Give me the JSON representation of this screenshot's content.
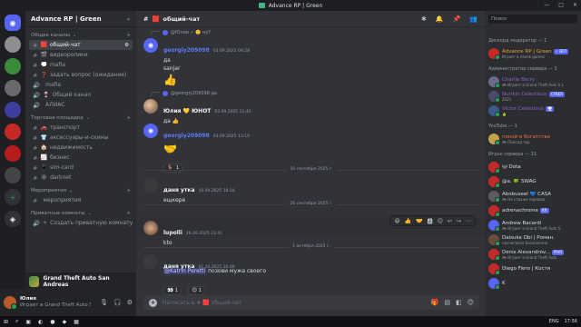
{
  "window": {
    "title": "Advance RP | Green",
    "controls": [
      "—",
      "□",
      "✕"
    ]
  },
  "servers": [
    {
      "icon": "home-icon",
      "glyph": "◉",
      "color": "#5865f2"
    },
    {
      "icon": "server-1-icon",
      "glyph": "",
      "color": "#8e8e8e"
    },
    {
      "icon": "server-2-icon",
      "glyph": "",
      "color": "#3b8b3b"
    },
    {
      "icon": "server-3-icon",
      "glyph": "",
      "color": "#6a6a6a"
    },
    {
      "icon": "server-4-icon",
      "glyph": "",
      "color": "#3c3f9e"
    },
    {
      "icon": "server-5-icon",
      "glyph": "",
      "color": "#c62828"
    },
    {
      "icon": "server-6-icon",
      "glyph": "",
      "color": "#b71c1c"
    },
    {
      "icon": "server-7-icon",
      "glyph": "",
      "color": "#444"
    },
    {
      "icon": "add-server-icon",
      "glyph": "+",
      "color": "#313338"
    },
    {
      "icon": "discover-icon",
      "glyph": "◈",
      "color": "#313338"
    }
  ],
  "guild": {
    "name": "Advance RP | Green"
  },
  "categories": [
    {
      "name": "Общие каналы",
      "channels": [
        {
          "label": "общий-чат",
          "prefix": "#",
          "emoji": "🟥",
          "active": true
        },
        {
          "label": "видеоролики",
          "prefix": "#",
          "emoji": "🎬",
          "active": false
        },
        {
          "label": "mafia",
          "prefix": "#",
          "emoji": "💭",
          "active": false
        },
        {
          "label": "задать вопрос (ожидание)",
          "prefix": "#",
          "emoji": "❓",
          "active": false
        },
        {
          "label": "mafia",
          "prefix": "🔊",
          "emoji": "",
          "active": false
        },
        {
          "label": "Общий канал",
          "prefix": "🔊",
          "emoji": "🍷",
          "active": false
        },
        {
          "label": "АЛИАС",
          "prefix": "🔊",
          "emoji": "",
          "active": false
        }
      ]
    },
    {
      "name": "Торговая площадка",
      "channels": [
        {
          "label": "транспорт",
          "prefix": "#",
          "emoji": "🚗",
          "active": false
        },
        {
          "label": "аксессуары-и-скины",
          "prefix": "#",
          "emoji": "👕",
          "active": false
        },
        {
          "label": "недвижимость",
          "prefix": "#",
          "emoji": "🏠",
          "active": false
        },
        {
          "label": "бизнес",
          "prefix": "#",
          "emoji": "📈",
          "active": false
        },
        {
          "label": "sim-card",
          "prefix": "#",
          "emoji": "📱",
          "active": false
        },
        {
          "label": "darknet",
          "prefix": "#",
          "emoji": "🕸",
          "active": false
        }
      ]
    },
    {
      "name": "Мероприятия",
      "channels": [
        {
          "label": "мероприятия",
          "prefix": "#",
          "emoji": "",
          "active": false
        }
      ]
    },
    {
      "name": "Приватные комнаты",
      "channels": [
        {
          "label": "Создать приватную комнату",
          "prefix": "🔊",
          "emoji": "+",
          "active": false
        }
      ]
    }
  ],
  "activity": {
    "game": "Grand Theft Auto San Andreas"
  },
  "user": {
    "name": "Юлия",
    "status": "Играет в Grand Theft Auto San"
  },
  "chat": {
    "channel": "общий-чат",
    "placeholder": "Написать в # 🟥 общий-чат",
    "messages": [
      {
        "reply_to": "@Юлия ✓ 🙂 ну?",
        "author": "georgiy209098",
        "time": "03.09.2025 09:28",
        "lines": [
          "да",
          "sanjar"
        ],
        "emoji": "👍"
      },
      {
        "reply_to": "@georgiy209098 да",
        "author": "Юлия 💛 ЮНОТ",
        "time": "03.09.2025 11:42",
        "lines": [
          "да 👍"
        ]
      },
      {
        "author": "georgiy209098",
        "time": "03.09.2025 13:10",
        "emoji": "🤝",
        "reaction": {
          "emoji": "🦌",
          "count": "1"
        }
      }
    ],
    "divider1": "10 сентября 2025 г.",
    "msg4": {
      "author": "даня утка",
      "time": "10.09.2025 18:14",
      "text": "ещкере"
    },
    "divider2": "26 сентября 2025 г.",
    "msg5": {
      "author": "lupolli",
      "time": "26.09.2025 23:41",
      "text": "kto"
    },
    "divider3": "1 октября 2025 г.",
    "msg6": {
      "author": "даня утка",
      "time": "01.10.2025 20:46",
      "line1": "я",
      "mention": "@Katrin Peretti",
      "line2": "позови мужа своего",
      "reaction_a": "👀 1",
      "reaction_b": "😊 1"
    },
    "hover_actions": [
      "😆",
      "👍",
      "🤝",
      "🅰",
      "😊",
      "↩",
      "↪",
      "⋯"
    ]
  },
  "members": {
    "search_placeholder": "Поиск",
    "groups": [
      {
        "name": "Дискорд модератор — 1",
        "items": [
          {
            "name": "Advance RP | Green",
            "sub": "Играет в /mesk-games",
            "color": "#f2a23a",
            "avatar": "#c62828",
            "tag": "✓ BOT"
          }
        ]
      },
      {
        "name": "Администратор сервера — 3",
        "items": [
          {
            "name": "Charlie Berry",
            "sub": "🎮 Играет в Grand Theft Auto V L",
            "color": "#8a63d2",
            "avatar": "#6a6a8a",
            "tag": ""
          },
          {
            "name": "Nurikin Celestious",
            "sub": "2021",
            "color": "#8a63d2",
            "avatar": "#4a4a6a",
            "tag": "CYBER"
          },
          {
            "name": "Victor Celestious",
            "sub": "🍐",
            "color": "#8a63d2",
            "avatar": "#3a5a8a",
            "tag": "🖥"
          }
        ]
      },
      {
        "name": "YouTube — 1",
        "items": [
          {
            "name": "покой в богатстве",
            "sub": "🎮 Пиксид тир",
            "color": "#f26d3a",
            "avatar": "#c4a34a",
            "tag": ""
          }
        ]
      },
      {
        "name": "Игрок сервера — 31",
        "items": [
          {
            "name": "🐱 Dota",
            "sub": "",
            "color": "#dbdee1",
            "avatar": "#c62828",
            "tag": ""
          },
          {
            "name": "@a. 🍀 SWAG",
            "sub": "",
            "color": "#dbdee1",
            "avatar": "#c62828",
            "tag": ""
          },
          {
            "name": "Abobuseel 💙 CASA",
            "sub": "🎮 На страже порядка",
            "color": "#dbdee1",
            "avatar": "#5c5c5c",
            "tag": ""
          },
          {
            "name": "adrenachrome",
            "sub": "",
            "color": "#dbdee1",
            "avatar": "#c62828",
            "tag": "RR"
          },
          {
            "name": "Andrew Bacardi",
            "sub": "🎮 Играет в Grand Theft Auto S",
            "color": "#dbdee1",
            "avatar": "#5865f2",
            "tag": ""
          },
          {
            "name": "Daisuke Obi | Роман.",
            "sub": "насчитался Бесконечно",
            "color": "#dbdee1",
            "avatar": "#6a4a3a",
            "tag": ""
          },
          {
            "name": "Denis Alexandrov...",
            "sub": "🎮 Играет в Grand Theft Auto",
            "color": "#dbdee1",
            "avatar": "#c62828",
            "tag": "PIVO"
          },
          {
            "name": "Diego Fiero | Костя",
            "sub": "",
            "color": "#dbdee1",
            "avatar": "#c62828",
            "tag": ""
          },
          {
            "name": "K",
            "sub": "",
            "color": "#dbdee1",
            "avatar": "#5865f2",
            "tag": ""
          }
        ]
      }
    ]
  },
  "taskbar": {
    "apps": [
      "⊞",
      "⌕",
      "▣",
      "◐",
      "●",
      "◆",
      "▦"
    ],
    "lang": "ENG",
    "time": "17:56"
  }
}
